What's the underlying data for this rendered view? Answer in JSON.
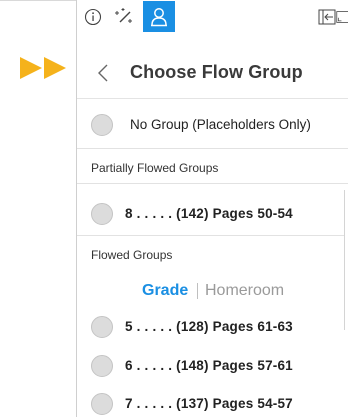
{
  "toolbar": {
    "items": [
      {
        "icon": "info-icon"
      },
      {
        "icon": "magic-wand-icon"
      },
      {
        "icon": "user-icon",
        "active": true
      },
      {
        "icon": "insert-left-icon"
      },
      {
        "icon": "expand-icon"
      }
    ],
    "accent": "#1a8fe3"
  },
  "header": {
    "title": "Choose Flow Group"
  },
  "no_group": {
    "label": "No Group (Placeholders Only)"
  },
  "partially_flowed": {
    "heading": "Partially Flowed Groups",
    "items": [
      {
        "label": "8 . . . . . (142) Pages 50-54"
      }
    ]
  },
  "flowed": {
    "heading": "Flowed Groups",
    "tabs": [
      {
        "label": "Grade",
        "selected": true
      },
      {
        "label": "Homeroom",
        "selected": false
      }
    ],
    "items": [
      {
        "label": "5 . . . . . (128) Pages 61-63"
      },
      {
        "label": "6 . . . . . (148) Pages 57-61"
      },
      {
        "label": "7 . . . . . (137) Pages 54-57"
      }
    ]
  },
  "colors": {
    "guide_arrow": "#f5b21b",
    "radio_fill": "#dcdcdc",
    "title_text": "#3a3a3a"
  }
}
